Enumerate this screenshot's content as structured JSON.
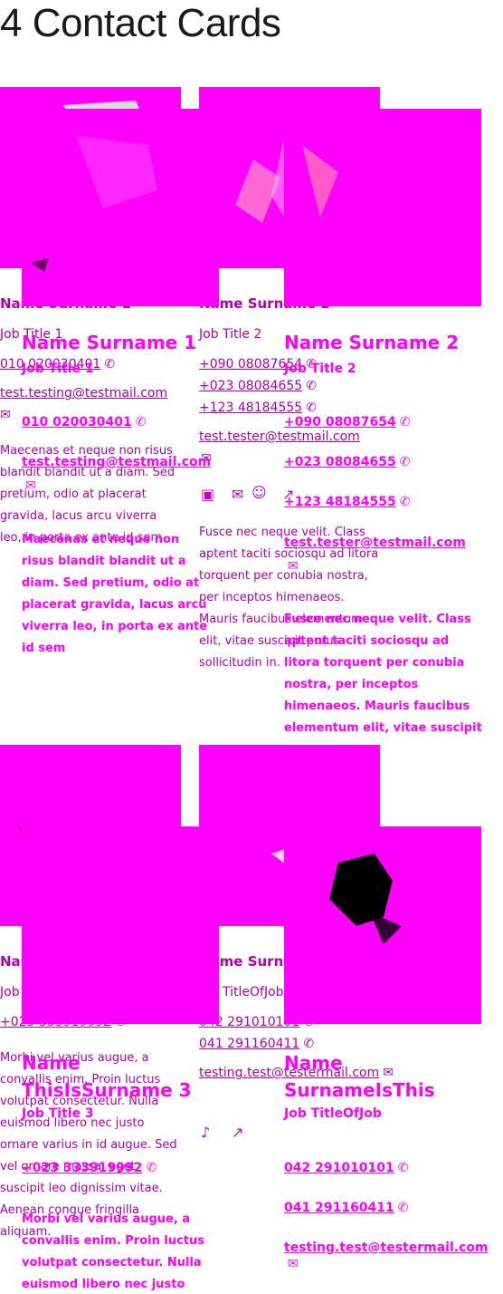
{
  "page_title": "4 Contact Cards",
  "icons": {
    "phone": "phone-icon",
    "mail": "mail-icon",
    "linkedin": "linkedin-icon",
    "smiley": "smiley-icon",
    "external": "external-link-icon",
    "tiktok": "tiktok-icon"
  },
  "colors": {
    "primary": "#ff00ff",
    "text_dark": "#1a1a1a"
  },
  "cards": [
    {
      "name": "Name Surname 1",
      "job": "Job Title 1",
      "phones": [
        "010 020030401"
      ],
      "email": "test.testing@testmail.com",
      "bio": "Maecenas et neque non risus blandit blandit ut a diam. Sed pretium, odio at placerat gravida, lacus arcu viverra leo, in porta ex ante id sem"
    },
    {
      "name": "Name Surname 2",
      "job": "Job Title 2",
      "phones": [
        "+090 08087654",
        "+023 08084655",
        "+123 48184555"
      ],
      "email": "test.tester@testmail.com",
      "bio": "Fusce nec neque velit. Class aptent taciti sociosqu ad litora torquent per conubia nostra, per inceptos himenaeos. Mauris faucibus elementum elit, vitae suscipit purus sollicitudin in."
    },
    {
      "name": "Name ThisIsSurname 3",
      "job": "Job Title 3",
      "phones": [
        "+023 333919992"
      ],
      "bio": "Morbi vel varius augue, a convallis enim. Proin luctus volutpat consectetur. Nulla euismod libero nec justo ornare varius in id augue. Sed vel ornare massa, eget suscipit leo dignissim vitae. Aenean congue fringilla aliquam."
    },
    {
      "name": "Name SurnameIsThis",
      "job": "Job TitleOfJob",
      "phones": [
        "042 291010101",
        "041 291160411"
      ],
      "email": "testing.test@testermail.com"
    }
  ]
}
